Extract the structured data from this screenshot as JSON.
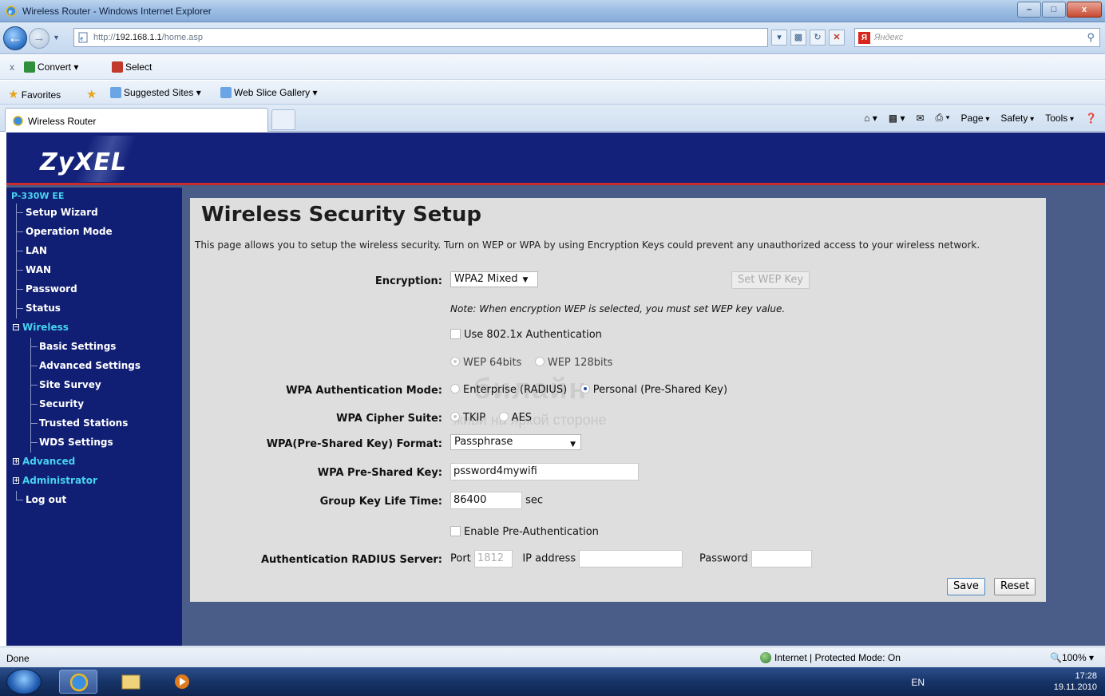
{
  "window": {
    "title": "Wireless Router - Windows Internet Explorer",
    "buttons": [
      "–",
      "□",
      "x"
    ]
  },
  "address_bar": {
    "url_prefix": "http://",
    "url_host": "192.168.1.1",
    "url_path": "/home.asp",
    "search_placeholder": "Яндекс"
  },
  "toolbar": {
    "close_label": "x",
    "convert_label": "Convert",
    "select_label": "Select"
  },
  "favorites_bar": {
    "favorites_label": "Favorites",
    "suggested_sites_label": "Suggested Sites",
    "web_slice_label": "Web Slice Gallery"
  },
  "tabs": [
    {
      "label": "Wireless Router"
    }
  ],
  "command_bar": {
    "page_label": "Page",
    "safety_label": "Safety",
    "tools_label": "Tools"
  },
  "router": {
    "logo": "ZyXEL",
    "model": "P-330W EE",
    "menu": [
      {
        "label": "Setup Wizard",
        "type": "item"
      },
      {
        "label": "Operation Mode",
        "type": "item"
      },
      {
        "label": "LAN",
        "type": "item"
      },
      {
        "label": "WAN",
        "type": "item"
      },
      {
        "label": "Password",
        "type": "item"
      },
      {
        "label": "Status",
        "type": "item"
      },
      {
        "label": "Wireless",
        "type": "folder",
        "expanded": true
      },
      {
        "label": "Basic Settings",
        "type": "sub"
      },
      {
        "label": "Advanced Settings",
        "type": "sub"
      },
      {
        "label": "Site Survey",
        "type": "sub"
      },
      {
        "label": "Security",
        "type": "sub"
      },
      {
        "label": "Trusted Stations",
        "type": "sub"
      },
      {
        "label": "WDS Settings",
        "type": "sub"
      },
      {
        "label": "Advanced",
        "type": "folder",
        "expanded": false
      },
      {
        "label": "Administrator",
        "type": "folder",
        "expanded": false
      },
      {
        "label": "Log out",
        "type": "item"
      }
    ]
  },
  "form": {
    "title": "Wireless Security Setup",
    "description": "This page allows you to setup the wireless security. Turn on WEP or WPA by using Encryption Keys could prevent any unauthorized access to your wireless network.",
    "encryption_label": "Encryption:",
    "encryption_value": "WPA2 Mixed",
    "set_wep_key_label": "Set WEP Key",
    "note": "Note: When encryption WEP is selected, you must set WEP key value.",
    "use_8021x_label": "Use 802.1x Authentication",
    "wep64_label": "WEP 64bits",
    "wep128_label": "WEP 128bits",
    "wpa_auth_mode_label": "WPA Authentication Mode:",
    "enterprise_label": "Enterprise (RADIUS)",
    "personal_label": "Personal (Pre-Shared Key)",
    "cipher_suite_label": "WPA Cipher Suite:",
    "tkip_label": "TKIP",
    "aes_label": "AES",
    "psk_format_label": "WPA(Pre-Shared Key) Format:",
    "psk_format_value": "Passphrase",
    "psk_label": "WPA Pre-Shared Key:",
    "psk_value": "pssword4mywifi",
    "group_key_label": "Group Key Life Time:",
    "group_key_value": "86400",
    "group_key_unit": "sec",
    "pre_auth_label": "Enable Pre-Authentication",
    "radius_label": "Authentication RADIUS Server:",
    "port_label": "Port",
    "port_value": "1812",
    "ip_label": "IP address",
    "ip_value": "",
    "password_label": "Password",
    "password_value": "",
    "save_label": "Save",
    "reset_label": "Reset"
  },
  "watermark": {
    "line1": "билайн",
    "line2": "живи на яркой стороне"
  },
  "status_bar": {
    "status": "Done",
    "zone": "Internet | Protected Mode: On",
    "zoom": "100%"
  },
  "taskbar": {
    "lang": "EN",
    "time": "17:28",
    "date": "19.11.2010"
  },
  "colors": {
    "header_bg": "#13217a",
    "accent_red": "#c72b2b",
    "menu_link": "#46d3f0",
    "content_bg": "#dedede"
  }
}
